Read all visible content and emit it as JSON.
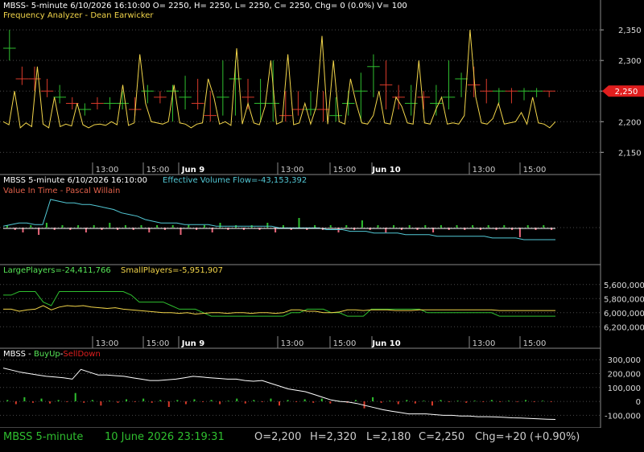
{
  "colors": {
    "background": "#000000",
    "grid": "#4a4a4a",
    "white": "#ffffff",
    "yellow": "#f2d54a",
    "green": "#2fbf2f",
    "red": "#d93a2a",
    "cyan": "#53c9d6",
    "salmon": "#e0604a",
    "pink_bar": "#e8667a",
    "ltgreen": "#57e657",
    "price_flag": "#e01e1e"
  },
  "pane1": {
    "header": "MBSS- 5-minute 6/10/2026 16:10:00 O= 2250, H= 2250, L= 2250, C= 2250, Chg= 0 (0.0%) V= 100",
    "subtitle": "Frequency Analyzer - Dean Earwicker",
    "price_flag": "2,250"
  },
  "pane2": {
    "header_left": "MBSS 5-minute  6/10/2026 16:10:00",
    "header_right": "Effective Volume Flow=-43,153,392",
    "subtitle": "Value In Time - Pascal Willain"
  },
  "pane3": {
    "large_players": "LargePlayers=-24,411,766",
    "small_players": "SmallPlayers=-5,951,907"
  },
  "pane4": {
    "title_prefix": "MBSS - ",
    "buy_up": "BuyUp",
    "separator": "-",
    "sell_down": "SellDown"
  },
  "status_bar": {
    "symbol": "MBSS  5-minute",
    "date": "10 June 2026 23:19:31",
    "open": "O=2,200",
    "high": "H=2,320",
    "low": "L=2,180",
    "close": "C=2,250",
    "change": "Chg=+20 (+0.90%)"
  },
  "chart_data": [
    {
      "type": "line",
      "pane": "price",
      "x_tick_labels": [
        "13:00",
        "15:00",
        "Jun 9",
        "13:00",
        "15:00",
        "Jun 10",
        "13:00",
        "15:00"
      ],
      "y_tick_labels": [
        "2,350",
        "2,300",
        "2,250",
        "2,200",
        "2,150"
      ],
      "ylim": [
        2136,
        2362
      ],
      "series": [
        {
          "name": "Frequency Analyzer",
          "color": "yellow",
          "values": [
            2200,
            2195,
            2250,
            2190,
            2198,
            2192,
            2290,
            2196,
            2190,
            2240,
            2192,
            2196,
            2193,
            2230,
            2195,
            2190,
            2195,
            2196,
            2194,
            2200,
            2195,
            2260,
            2194,
            2198,
            2310,
            2230,
            2200,
            2198,
            2196,
            2200,
            2260,
            2198,
            2196,
            2190,
            2196,
            2198,
            2270,
            2240,
            2196,
            2200,
            2194,
            2320,
            2196,
            2230,
            2198,
            2195,
            2225,
            2300,
            2196,
            2200,
            2310,
            2195,
            2198,
            2230,
            2196,
            2225,
            2340,
            2196,
            2300,
            2200,
            2196,
            2270,
            2230,
            2198,
            2196,
            2210,
            2250,
            2198,
            2196,
            2240,
            2225,
            2198,
            2196,
            2300,
            2198,
            2196,
            2220,
            2240,
            2196,
            2198,
            2196,
            2210,
            2350,
            2240,
            2198,
            2196,
            2205,
            2230,
            2196,
            2198,
            2200,
            2215,
            2196,
            2240,
            2198,
            2196,
            2190,
            2200
          ]
        }
      ],
      "price_bars": {
        "high": [
          2350,
          2290,
          2290,
          2270,
          2260,
          2240,
          2230,
          2240,
          2240,
          2250,
          2240,
          2260,
          2250,
          2260,
          2275,
          2270,
          2250,
          2300,
          2300,
          2270,
          2270,
          2300,
          2250,
          2250,
          2250,
          2250,
          2240,
          2250,
          2280,
          2310,
          2300,
          2260,
          2260,
          2250,
          2260,
          2300,
          2280,
          2290,
          2270,
          2255,
          2255,
          2255,
          2255,
          2250
        ],
        "low": [
          2300,
          2260,
          2250,
          2240,
          2230,
          2220,
          2210,
          2220,
          2220,
          2220,
          2210,
          2230,
          2230,
          2200,
          2220,
          2220,
          2200,
          2210,
          2210,
          2220,
          2200,
          2200,
          2200,
          2210,
          2210,
          2200,
          2200,
          2210,
          2200,
          2240,
          2220,
          2220,
          2210,
          2220,
          2210,
          2220,
          2240,
          2240,
          2230,
          2230,
          2230,
          2235,
          2240,
          2240
        ],
        "close": [
          2320,
          2270,
          2270,
          2250,
          2240,
          2230,
          2220,
          2230,
          2230,
          2230,
          2220,
          2250,
          2240,
          2250,
          2240,
          2230,
          2210,
          2240,
          2270,
          2240,
          2230,
          2230,
          2210,
          2220,
          2220,
          2220,
          2210,
          2230,
          2250,
          2290,
          2260,
          2240,
          2230,
          2240,
          2230,
          2240,
          2270,
          2260,
          2250,
          2250,
          2250,
          2250,
          2250,
          2250
        ],
        "up": [
          1,
          0,
          0,
          0,
          1,
          0,
          1,
          0,
          1,
          1,
          0,
          1,
          0,
          1,
          1,
          0,
          0,
          1,
          1,
          0,
          1,
          1,
          0,
          0,
          1,
          0,
          1,
          1,
          1,
          1,
          0,
          0,
          1,
          0,
          1,
          1,
          1,
          0,
          0,
          1,
          0,
          1,
          1,
          0
        ]
      }
    },
    {
      "type": "line",
      "pane": "value-in-time",
      "series": [
        {
          "name": "Effective Volume Flow",
          "color": "cyan",
          "values": [
            2,
            3,
            4,
            4,
            3,
            3,
            18,
            17,
            16,
            16,
            15,
            15,
            14,
            13,
            12,
            10,
            9,
            8,
            6,
            5,
            4,
            4,
            4,
            3,
            3,
            3,
            3,
            2,
            2,
            2,
            2,
            2,
            2,
            2,
            2,
            1,
            1,
            1,
            1,
            1,
            1,
            0,
            0,
            0,
            -1,
            -1,
            -1,
            -2,
            -2,
            -2,
            -2,
            -3,
            -3,
            -3,
            -3,
            -4,
            -4,
            -4,
            -4,
            -4,
            -4,
            -4,
            -5,
            -5,
            -5,
            -5,
            -6,
            -6,
            -6,
            -6,
            -6
          ]
        },
        {
          "name": "",
          "color": "white",
          "values": [
            0,
            0,
            0,
            0,
            0,
            0,
            0,
            0,
            0,
            0,
            0,
            0,
            0,
            0,
            0,
            0,
            0,
            0,
            0,
            0,
            0,
            0,
            0,
            0,
            0,
            0,
            0,
            0,
            0,
            0,
            0,
            0,
            0,
            0,
            0,
            0,
            0,
            0,
            0,
            0,
            0,
            0,
            0,
            0,
            0,
            0,
            0,
            0,
            0,
            0,
            0,
            0,
            0,
            0,
            0,
            0,
            0,
            0,
            0,
            0,
            0,
            0,
            0,
            0,
            0,
            0,
            0,
            0,
            0,
            0,
            0
          ]
        }
      ],
      "histogram": [
        1,
        -1,
        -2,
        1,
        -3,
        2,
        -1,
        1,
        -1,
        1,
        -2,
        1,
        -1,
        2,
        -1,
        1,
        -1,
        1,
        -2,
        1,
        -1,
        1,
        -3,
        1,
        -1,
        1,
        -2,
        2,
        -1,
        1,
        -1,
        1,
        -1,
        2,
        -2,
        1,
        -1,
        4,
        -1,
        1,
        -1,
        1,
        -2,
        1,
        -1,
        3,
        -1,
        1,
        -2,
        1,
        -1,
        1,
        -1,
        1,
        -2,
        1,
        -1,
        1,
        -1,
        1,
        -1,
        1,
        -1,
        1,
        -1,
        -4,
        1,
        -1,
        1,
        -1
      ]
    },
    {
      "type": "line",
      "pane": "players",
      "x_tick_labels": [
        "13:00",
        "15:00",
        "Jun 9",
        "13:00",
        "15:00",
        "Jun 10",
        "13:00",
        "15:00"
      ],
      "y_tick_labels": [
        "5,600,000",
        "5,800,000",
        "6,000,000",
        "6,200,000"
      ],
      "series": [
        {
          "name": "LargePlayers",
          "color": "green",
          "values": [
            5750000,
            5750000,
            5700000,
            5700000,
            5700000,
            5850000,
            5900000,
            5700000,
            5700000,
            5700000,
            5700000,
            5700000,
            5700000,
            5700000,
            5700000,
            5700000,
            5750000,
            5850000,
            5850000,
            5850000,
            5850000,
            5900000,
            5950000,
            5950000,
            5950000,
            6000000,
            6050000,
            6050000,
            6050000,
            6050000,
            6050000,
            6050000,
            6050000,
            6050000,
            6050000,
            6050000,
            6000000,
            6000000,
            5950000,
            5950000,
            5950000,
            6000000,
            6000000,
            6050000,
            6050000,
            6050000,
            5950000,
            5950000,
            5950000,
            5950000,
            5950000,
            5950000,
            5950000,
            6000000,
            6000000,
            6000000,
            6000000,
            6000000,
            6000000,
            6000000,
            6000000,
            6000000,
            6050000,
            6050000,
            6050000,
            6050000,
            6050000,
            6050000,
            6050000,
            6050000
          ]
        },
        {
          "name": "SmallPlayers",
          "color": "yellow",
          "values": [
            5950000,
            5950000,
            5980000,
            5960000,
            5950000,
            5900000,
            5960000,
            5920000,
            5900000,
            5910000,
            5900000,
            5920000,
            5930000,
            5940000,
            5930000,
            5950000,
            5960000,
            5970000,
            5980000,
            5990000,
            6000000,
            6000000,
            6010000,
            6000000,
            6020000,
            6010000,
            6000000,
            6000000,
            6010000,
            6000000,
            6000000,
            6010000,
            6000000,
            6000000,
            6010000,
            6000000,
            5960000,
            5960000,
            5980000,
            5980000,
            6000000,
            6000000,
            5990000,
            5960000,
            5960000,
            5970000,
            5960000,
            5960000,
            5960000,
            5970000,
            5970000,
            5970000,
            5960000,
            5960000,
            5960000,
            5960000,
            5960000,
            5960000,
            5960000,
            5960000,
            5960000,
            5960000,
            5970000,
            5970000,
            5970000,
            5970000,
            5970000,
            5970000,
            5970000,
            5970000
          ]
        }
      ]
    },
    {
      "type": "line",
      "pane": "buyup-selldown",
      "y_tick_labels": [
        "300,000",
        "200,000",
        "100,000",
        "0",
        "-100,000"
      ],
      "ylim": [
        -150000,
        330000
      ],
      "series": [
        {
          "name": "",
          "color": "white",
          "values": [
            240000,
            225000,
            210000,
            200000,
            190000,
            180000,
            175000,
            170000,
            160000,
            230000,
            210000,
            190000,
            190000,
            185000,
            180000,
            170000,
            160000,
            150000,
            150000,
            155000,
            160000,
            170000,
            180000,
            175000,
            170000,
            165000,
            160000,
            160000,
            150000,
            145000,
            150000,
            130000,
            110000,
            90000,
            80000,
            70000,
            50000,
            30000,
            10000,
            0,
            -5000,
            -15000,
            -30000,
            -45000,
            -60000,
            -70000,
            -80000,
            -90000,
            -90000,
            -90000,
            -95000,
            -100000,
            -100000,
            -105000,
            -105000,
            -110000,
            -110000,
            -112000,
            -115000,
            -118000,
            -120000,
            -122000,
            -125000,
            -128000,
            -130000
          ]
        }
      ],
      "histogram": [
        10000,
        -20000,
        30000,
        -10000,
        20000,
        -15000,
        10000,
        -5000,
        60000,
        -10000,
        10000,
        -30000,
        5000,
        -10000,
        15000,
        -5000,
        20000,
        -10000,
        10000,
        -40000,
        10000,
        -20000,
        15000,
        -5000,
        10000,
        -20000,
        5000,
        20000,
        -15000,
        10000,
        -5000,
        20000,
        -30000,
        10000,
        -5000,
        15000,
        -10000,
        20000,
        -15000,
        5000,
        -10000,
        10000,
        -50000,
        30000,
        -10000,
        5000,
        -20000,
        10000,
        -15000,
        5000,
        -30000,
        10000,
        -5000,
        5000,
        -10000,
        5000,
        -5000,
        10000,
        -5000,
        5000,
        -5000,
        10000,
        -5000,
        5000,
        -5000
      ]
    }
  ]
}
